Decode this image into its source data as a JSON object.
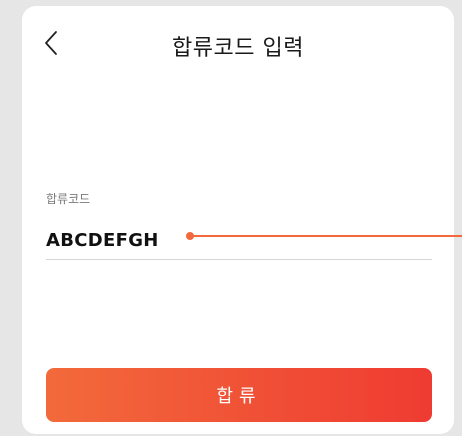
{
  "header": {
    "back_icon": "chevron-left-icon",
    "title": "합류코드 입력"
  },
  "form": {
    "code_label": "합류코드",
    "code_value": "ABCDEFGH"
  },
  "actions": {
    "join_label": "합류"
  },
  "colors": {
    "accent_start": "#f26a3b",
    "accent_end": "#ef3b32",
    "pointer": "#f26a3b"
  }
}
